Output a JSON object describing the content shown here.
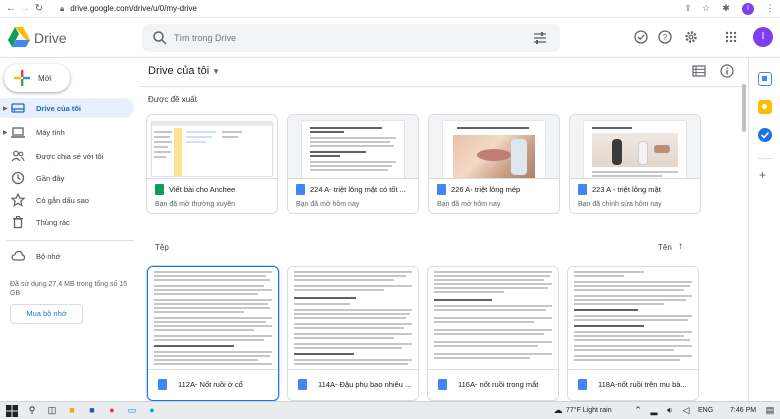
{
  "browser": {
    "url": "drive.google.com/drive/u/0/my-drive",
    "profile_initial": "I"
  },
  "header": {
    "brand": "Drive",
    "search_placeholder": "Tìm trong Drive",
    "avatar_initial": "I"
  },
  "sidebar": {
    "new_label": "Mới",
    "items": [
      {
        "label": "Drive của tôi",
        "icon": "drive-icon",
        "active": true
      },
      {
        "label": "Máy tính",
        "icon": "computer-icon",
        "active": false
      },
      {
        "label": "Được chia sẻ với tôi",
        "icon": "shared-icon",
        "active": false
      },
      {
        "label": "Gần đây",
        "icon": "clock-icon",
        "active": false
      },
      {
        "label": "Có gắn dấu sao",
        "icon": "star-icon",
        "active": false
      },
      {
        "label": "Thùng rác",
        "icon": "trash-icon",
        "active": false
      }
    ],
    "storage_label": "Bộ nhớ",
    "storage_used": "Đã sử dụng 27,4 MB trong tổng số 15 GB",
    "buy_storage": "Mua bộ nhớ"
  },
  "main": {
    "title": "Drive của tôi",
    "suggested_label": "Được đề xuất",
    "suggested": [
      {
        "title": "Viết bài cho Anchee",
        "subtitle": "Bạn đã mở thường xuyên",
        "type": "sheet"
      },
      {
        "title": "224 A- triệt lông mặt có tốt ...",
        "subtitle": "Bạn đã mở hôm nay",
        "type": "doc"
      },
      {
        "title": "226 A- triệt lông mép",
        "subtitle": "Bạn đã mở hôm nay",
        "type": "doc"
      },
      {
        "title": "223 A - triệt lông mặt",
        "subtitle": "Bạn đã chỉnh sửa hôm nay",
        "type": "doc"
      }
    ],
    "files_label": "Tệp",
    "sort_label": "Tên",
    "files": [
      {
        "name": "112A- Nốt ruồi ở cổ",
        "selected": true
      },
      {
        "name": "114A- Đậu phụ bao nhiêu ...",
        "selected": false
      },
      {
        "name": "116A- nốt ruồi trong mắt",
        "selected": false
      },
      {
        "name": "118A-nốt ruồi trên mu bà...",
        "selected": false
      }
    ]
  },
  "colors": {
    "accent": "#1a73e8",
    "active_bg": "#e8f0fe",
    "doc_blue": "#4285f4",
    "sheet_green": "#0f9d58"
  },
  "taskbar": {
    "weather": "77°F  Light rain",
    "lang": "ENG",
    "time": "7:46 PM"
  }
}
